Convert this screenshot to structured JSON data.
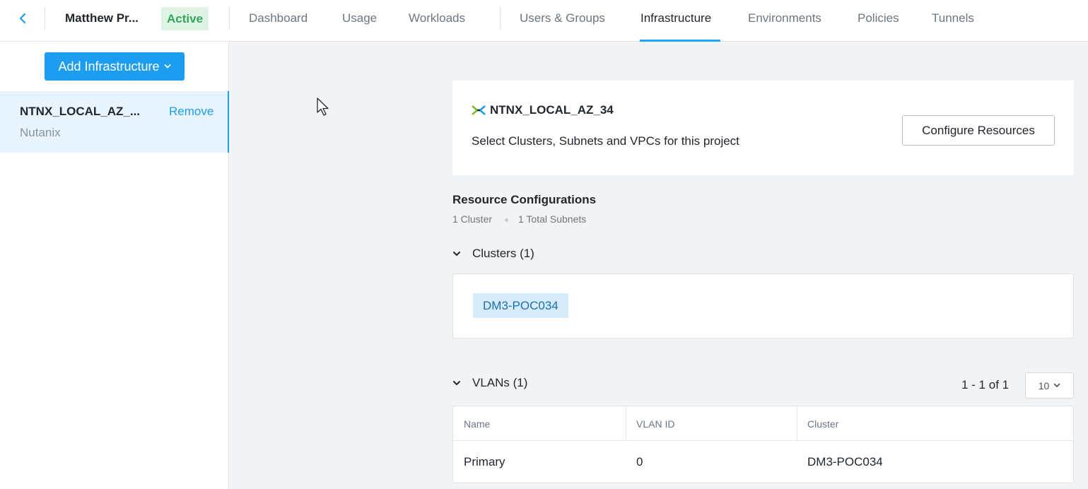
{
  "header": {
    "project_name": "Matthew Pr...",
    "status": "Active",
    "tabs": [
      {
        "label": "Dashboard"
      },
      {
        "label": "Usage"
      },
      {
        "label": "Workloads"
      },
      {
        "label": "Users & Groups"
      },
      {
        "label": "Infrastructure"
      },
      {
        "label": "Environments"
      },
      {
        "label": "Policies"
      },
      {
        "label": "Tunnels"
      }
    ],
    "active_tab": "Infrastructure"
  },
  "sidebar": {
    "add_button": "Add Infrastructure",
    "items": [
      {
        "name": "NTNX_LOCAL_AZ_...",
        "action": "Remove",
        "type": "Nutanix"
      }
    ]
  },
  "account_card": {
    "title": "NTNX_LOCAL_AZ_34",
    "subtitle": "Select Clusters, Subnets and VPCs for this project",
    "configure_button": "Configure Resources"
  },
  "resource_configurations": {
    "title": "Resource Configurations",
    "cluster_count": "1 Cluster",
    "subnet_count": "1 Total Subnets"
  },
  "clusters": {
    "label": "Clusters (1)",
    "items": [
      "DM3-POC034"
    ]
  },
  "vlans": {
    "label": "VLANs (1)",
    "pagination": "1 - 1 of 1",
    "page_size": "10",
    "columns": [
      "Name",
      "VLAN ID",
      "Cluster"
    ],
    "rows": [
      {
        "name": "Primary",
        "vlan_id": "0",
        "cluster": "DM3-POC034"
      }
    ]
  },
  "colors": {
    "accent": "#1d9df0",
    "active_badge_bg": "#dff3e4",
    "active_badge_text": "#36a35a",
    "chip_bg": "#d7ebfb"
  }
}
